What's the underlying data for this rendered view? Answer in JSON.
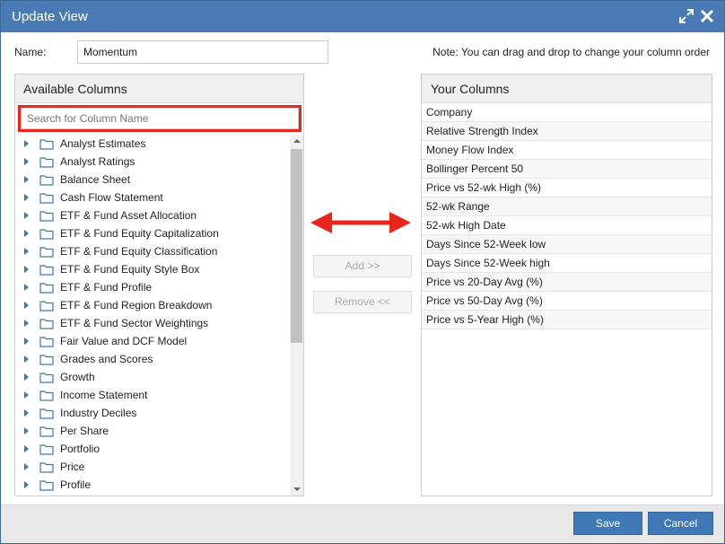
{
  "dialog": {
    "title": "Update View",
    "expand_icon": "expand-icon",
    "close_icon": "close-icon"
  },
  "name_field": {
    "label": "Name:",
    "value": "Momentum"
  },
  "note": "Note: You can drag and drop to change your column order",
  "available": {
    "header": "Available Columns",
    "search_placeholder": "Search for Column Name",
    "highlight_color": "#e8261c",
    "items": [
      {
        "label": "Analyst Estimates"
      },
      {
        "label": "Analyst Ratings"
      },
      {
        "label": "Balance Sheet"
      },
      {
        "label": "Cash Flow Statement"
      },
      {
        "label": "ETF & Fund Asset Allocation"
      },
      {
        "label": "ETF & Fund Equity Capitalization"
      },
      {
        "label": "ETF & Fund Equity Classification"
      },
      {
        "label": "ETF & Fund Equity Style Box"
      },
      {
        "label": "ETF & Fund Profile"
      },
      {
        "label": "ETF & Fund Region Breakdown"
      },
      {
        "label": "ETF & Fund Sector Weightings"
      },
      {
        "label": "Fair Value and DCF Model"
      },
      {
        "label": "Grades and Scores"
      },
      {
        "label": "Growth"
      },
      {
        "label": "Income Statement"
      },
      {
        "label": "Industry Deciles"
      },
      {
        "label": "Per Share"
      },
      {
        "label": "Portfolio"
      },
      {
        "label": "Price"
      },
      {
        "label": "Profile"
      }
    ]
  },
  "transfer": {
    "add_label": "Add >>",
    "remove_label": "Remove <<",
    "arrow_color": "#e8261c"
  },
  "selected": {
    "header": "Your Columns",
    "items": [
      {
        "label": "Company"
      },
      {
        "label": "Relative Strength Index"
      },
      {
        "label": "Money Flow Index"
      },
      {
        "label": "Bollinger Percent 50"
      },
      {
        "label": "Price vs 52-wk High (%)"
      },
      {
        "label": "52-wk Range"
      },
      {
        "label": "52-wk High Date"
      },
      {
        "label": "Days Since 52-Week low"
      },
      {
        "label": "Days Since 52-Week high"
      },
      {
        "label": "Price vs 20-Day Avg (%)"
      },
      {
        "label": "Price vs 50-Day Avg (%)"
      },
      {
        "label": "Price vs 5-Year High (%)"
      }
    ]
  },
  "footer": {
    "save_label": "Save",
    "cancel_label": "Cancel"
  },
  "colors": {
    "titlebar": "#4a7ab3",
    "primary_button": "#3f78b4"
  }
}
